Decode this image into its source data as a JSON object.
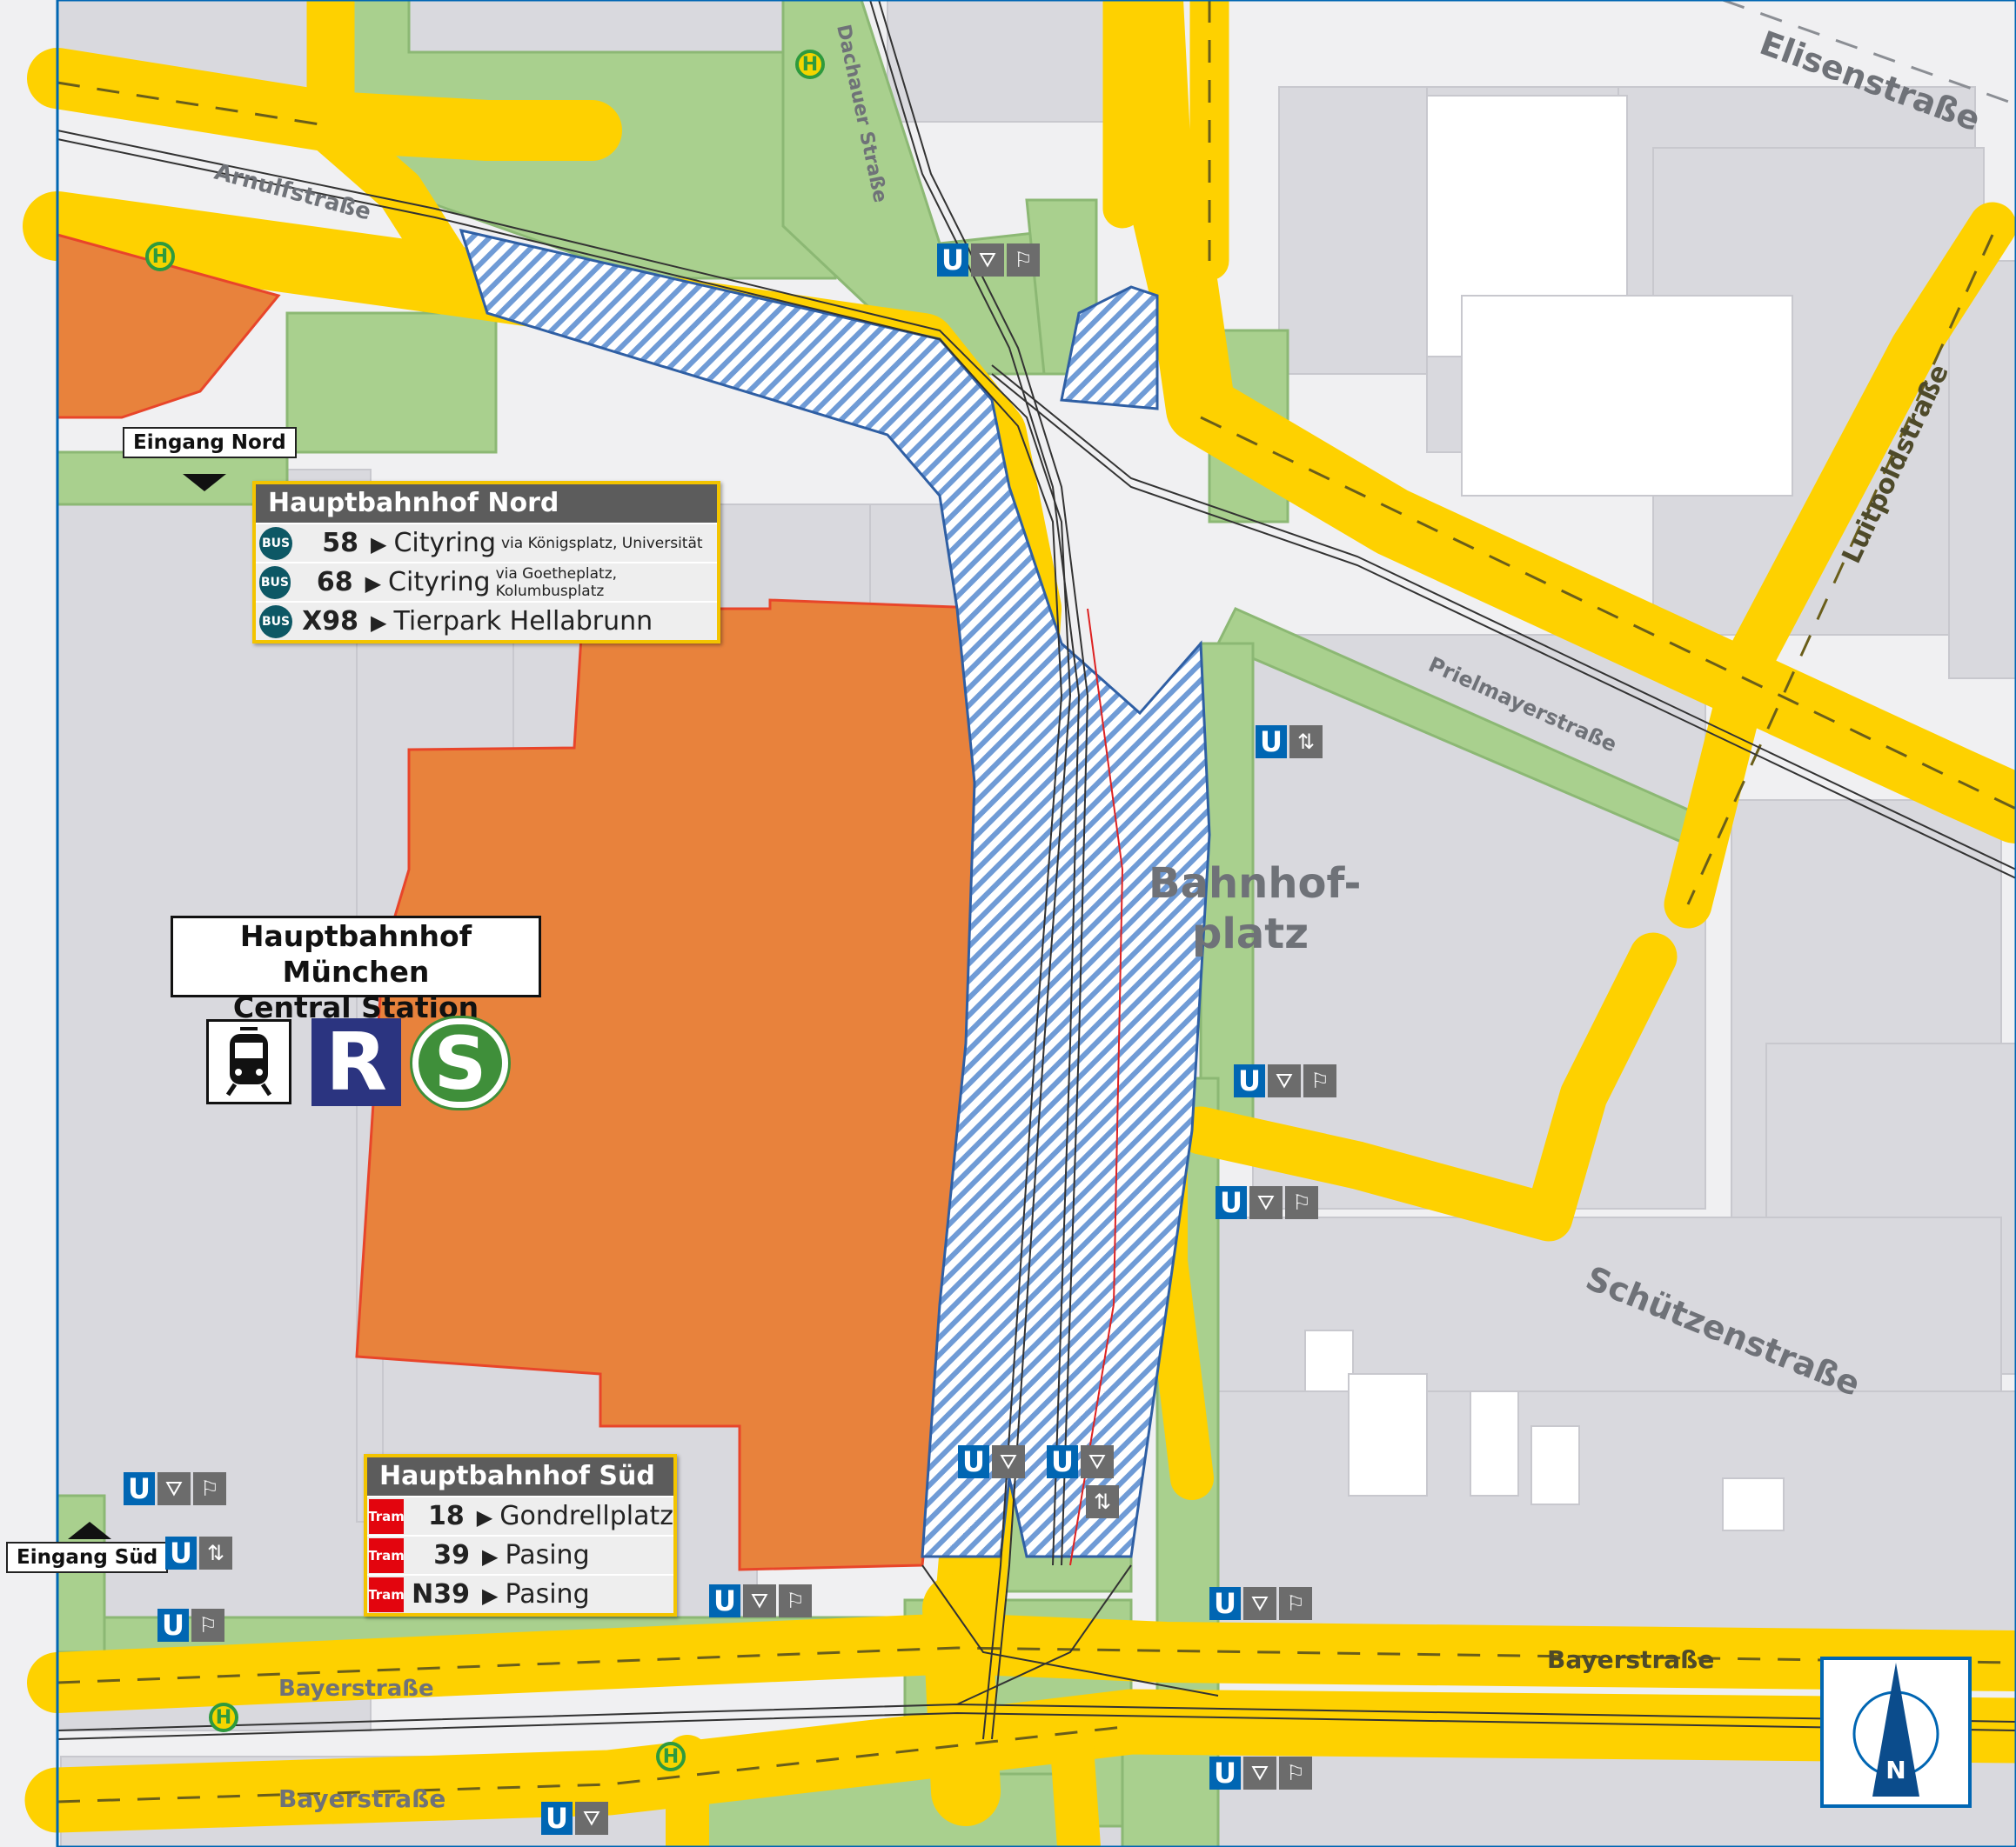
{
  "streets": {
    "elisenstrasse": "Elisenstraße",
    "dachauer": "Dachauer Straße",
    "arnulf": "Arnulfstraße",
    "luitpold": "Luitpoldstraße",
    "prielmayer": "Prielmayerstraße",
    "schuetzen": "Schützenstraße",
    "bayer": "Bayerstraße",
    "bahnhofplatz_1": "Bahnhof-",
    "bahnhofplatz_2": "platz"
  },
  "entrances": {
    "nord": "Eingang Nord",
    "sued": "Eingang Süd"
  },
  "station": {
    "name_line1": "Hauptbahnhof München",
    "name_line2": "Central Station",
    "r_symbol": "R",
    "s_symbol": "S"
  },
  "stop_nord": {
    "title": "Hauptbahnhof Nord",
    "routes": [
      {
        "mode": "BUS",
        "line": "58",
        "arrow": "▶",
        "destination": "Cityring",
        "via": "via Königsplatz, Universität"
      },
      {
        "mode": "BUS",
        "line": "68",
        "arrow": "▶",
        "destination": "Cityring",
        "via": "via Goetheplatz, Kolumbusplatz"
      },
      {
        "mode": "BUS",
        "line": "X98",
        "arrow": "▶",
        "destination": "Tierpark Hellabrunn",
        "via": ""
      }
    ]
  },
  "stop_sued": {
    "title": "Hauptbahnhof Süd",
    "routes": [
      {
        "mode": "Tram",
        "line": "18",
        "arrow": "▶",
        "destination": "Gondrellplatz"
      },
      {
        "mode": "Tram",
        "line": "39",
        "arrow": "▶",
        "destination": "Pasing"
      },
      {
        "mode": "Tram",
        "line": "N39",
        "arrow": "▶",
        "destination": "Pasing"
      }
    ]
  },
  "symbols": {
    "u": "U",
    "h": "H",
    "north": "N",
    "escalator": "⛛",
    "stairs": "⚐",
    "elevator": "⇅"
  },
  "colors": {
    "road": "#fed100",
    "green": "#a9d08e",
    "station": "#e8823c",
    "building": "#d9d9de",
    "ubahn": "#0066b3",
    "bus_badge": "#0d5865",
    "tram_badge": "#e3050e",
    "rail_pattern": "#4c7fc2"
  }
}
